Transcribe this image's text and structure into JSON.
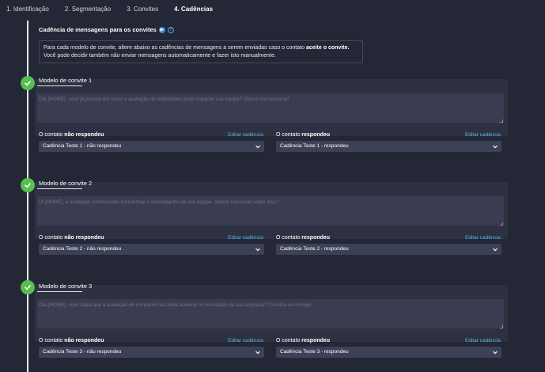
{
  "steps": [
    {
      "label": "1. Identificação",
      "active": false
    },
    {
      "label": "2. Segmentação",
      "active": false
    },
    {
      "label": "3. Convites",
      "active": false
    },
    {
      "label": "4. Cadências",
      "active": true
    }
  ],
  "section": {
    "title": "Cadência de mensagens para os convites",
    "info_line1_pre": "Para cada modelo de convite, altere abaixo as cadências de mensagens a serem enviadas caso o contato ",
    "info_line1_bold": "aceite o convite.",
    "info_line2": "Você pode decidir também não enviar mensagens automaticamente e fazer isto manualmente."
  },
  "labels": {
    "no_reply_prefix": "O contato ",
    "no_reply_bold": "não respondeu",
    "reply_prefix": "O contato ",
    "reply_bold": "respondeu",
    "edit": "Editar cadência"
  },
  "cards": [
    {
      "title": "Modelo de convite 1",
      "message": "Olá {NOME}, você já pensou em como a avaliação de habilidades pode impactar sua equipe? Vamos nos conectar!",
      "no_reply_value": "Cadência Teste 1 - não respondeu",
      "reply_value": "Cadência Teste 1 - respondeu"
    },
    {
      "title": "Modelo de convite 2",
      "message": "Oi {NOME}, a avaliação correta pode transformar o desempenho da sua equipe. Vamos conversar sobre isso?",
      "no_reply_value": "Cadência Teste 2 - não respondeu",
      "reply_value": "Cadência Teste 2 - respondeu"
    },
    {
      "title": "Modelo de convite 3",
      "message": "Olá {NOME}, você sabia que a avaliação de competências pode acelerar os resultados da sua empresa? Conecte-se comigo!",
      "no_reply_value": "Cadência Teste 3 - não respondeu",
      "reply_value": "Cadência Teste 3 - respondeu"
    }
  ]
}
